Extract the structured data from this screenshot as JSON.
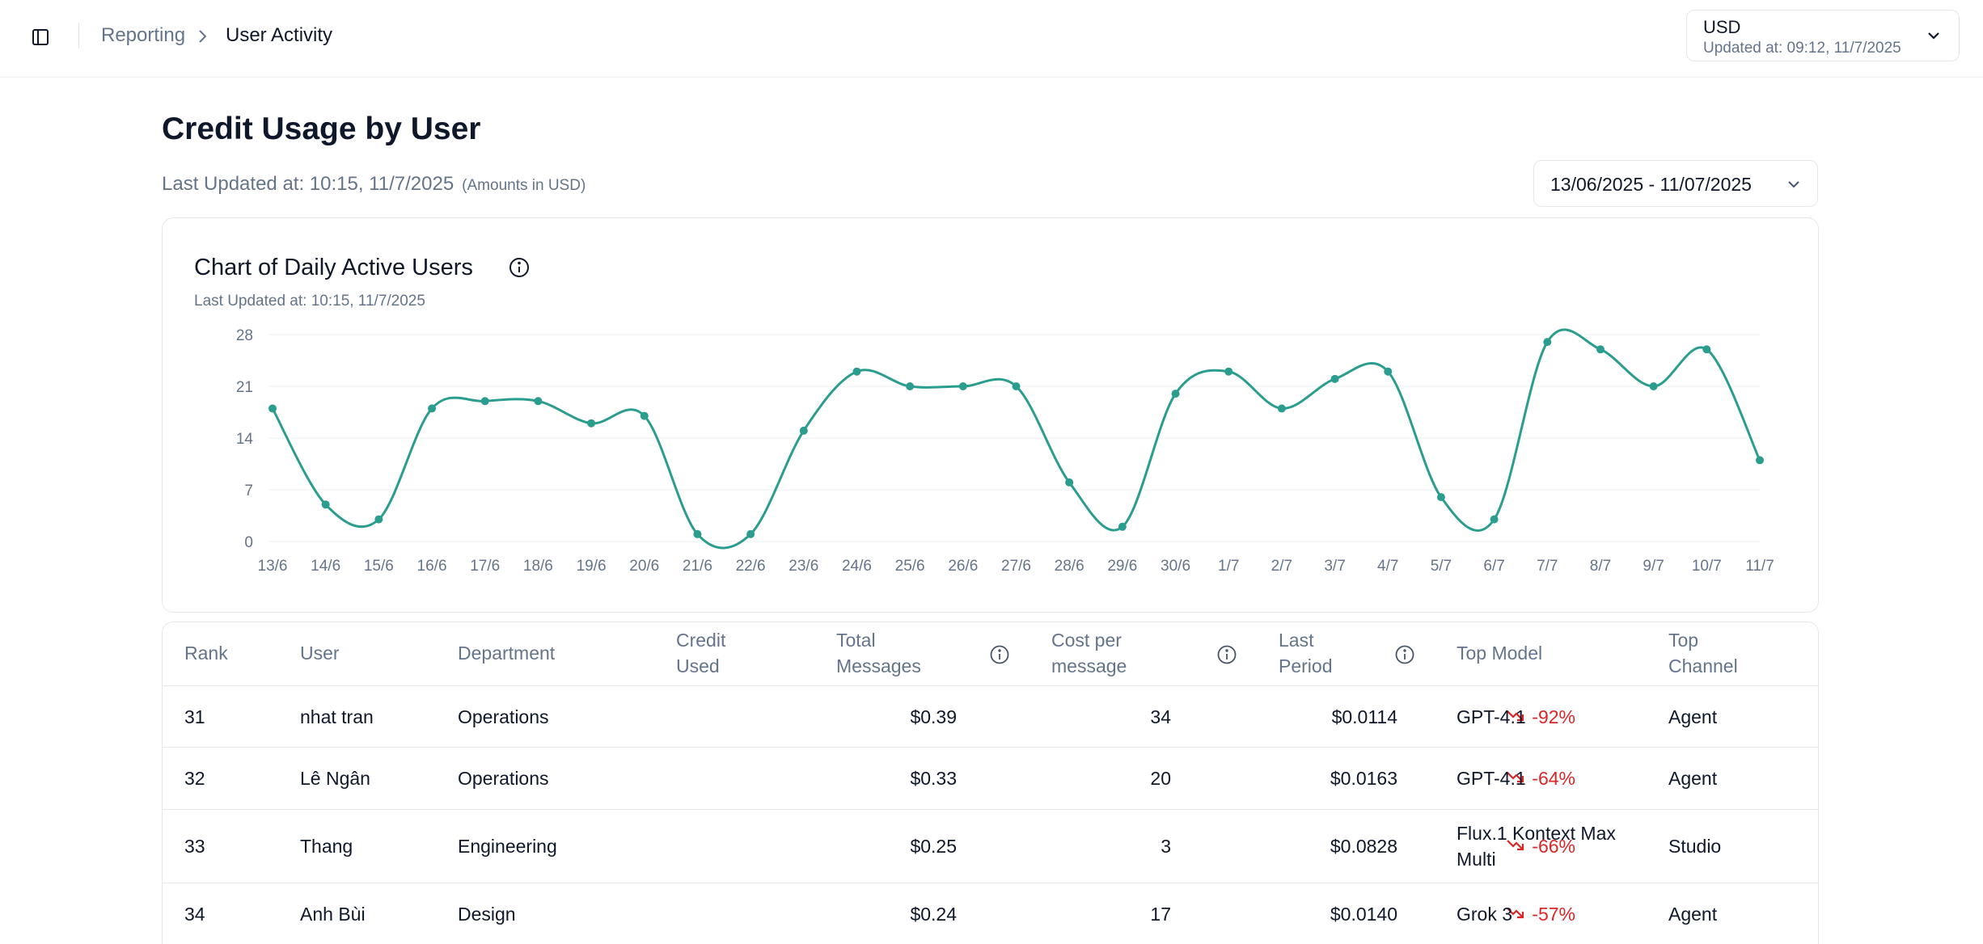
{
  "header": {
    "breadcrumb_parent": "Reporting",
    "breadcrumb_current": "User Activity",
    "currency": "USD",
    "currency_updated": "Updated at: 09:12, 11/7/2025"
  },
  "page": {
    "title": "Credit Usage by User",
    "last_updated": "Last Updated at: 10:15, 11/7/2025",
    "amounts_note": "(Amounts in USD)",
    "date_range": "13/06/2025 - 11/07/2025"
  },
  "chart": {
    "title": "Chart of Daily Active Users",
    "updated": "Last Updated at: 10:15, 11/7/2025"
  },
  "chart_data": {
    "type": "line",
    "title": "Chart of Daily Active Users",
    "xlabel": "",
    "ylabel": "",
    "ylim": [
      0,
      28
    ],
    "yticks": [
      0,
      7,
      14,
      21,
      28
    ],
    "grid": true,
    "color": "#2a9d8f",
    "categories": [
      "13/6",
      "14/6",
      "15/6",
      "16/6",
      "17/6",
      "18/6",
      "19/6",
      "20/6",
      "21/6",
      "22/6",
      "23/6",
      "24/6",
      "25/6",
      "26/6",
      "27/6",
      "28/6",
      "29/6",
      "30/6",
      "1/7",
      "2/7",
      "3/7",
      "4/7",
      "5/7",
      "6/7",
      "7/7",
      "8/7",
      "9/7",
      "10/7",
      "11/7"
    ],
    "values": [
      18,
      5,
      3,
      18,
      19,
      19,
      16,
      17,
      1,
      1,
      15,
      23,
      21,
      21,
      21,
      8,
      2,
      20,
      23,
      18,
      22,
      23,
      6,
      3,
      27,
      26,
      21,
      26,
      11
    ]
  },
  "table": {
    "headers": {
      "rank": "Rank",
      "user": "User",
      "department": "Department",
      "credit_1": "Credit",
      "credit_2": "Used",
      "messages_1": "Total",
      "messages_2": "Messages",
      "cost_1": "Cost per",
      "cost_2": "message",
      "period_1": "Last",
      "period_2": "Period",
      "model": "Top Model",
      "channel_1": "Top",
      "channel_2": "Channel"
    },
    "rows": [
      {
        "rank": "31",
        "user": "nhat tran",
        "department": "Operations",
        "credit": "$0.39",
        "messages": "34",
        "cost": "$0.0114",
        "period": "-92%",
        "model": "GPT-4.1",
        "model_2": "",
        "channel": "Agent"
      },
      {
        "rank": "32",
        "user": "Lê Ngân",
        "department": "Operations",
        "credit": "$0.33",
        "messages": "20",
        "cost": "$0.0163",
        "period": "-64%",
        "model": "GPT-4.1",
        "model_2": "",
        "channel": "Agent"
      },
      {
        "rank": "33",
        "user": "Thang",
        "department": "Engineering",
        "credit": "$0.25",
        "messages": "3",
        "cost": "$0.0828",
        "period": "-66%",
        "model": "Flux.1 Kontext Max",
        "model_2": "Multi",
        "channel": "Studio"
      },
      {
        "rank": "34",
        "user": "Anh Bùi",
        "department": "Design",
        "credit": "$0.24",
        "messages": "17",
        "cost": "$0.0140",
        "period": "-57%",
        "model": "Grok 3",
        "model_2": "",
        "channel": "Agent"
      }
    ]
  },
  "icons": {
    "sidebar_toggle": "sidebar-toggle-icon",
    "breadcrumb_sep": "chevron-right-icon",
    "dropdown": "chevron-down-icon",
    "info": "info-icon",
    "trend_down": "trend-down-icon"
  }
}
